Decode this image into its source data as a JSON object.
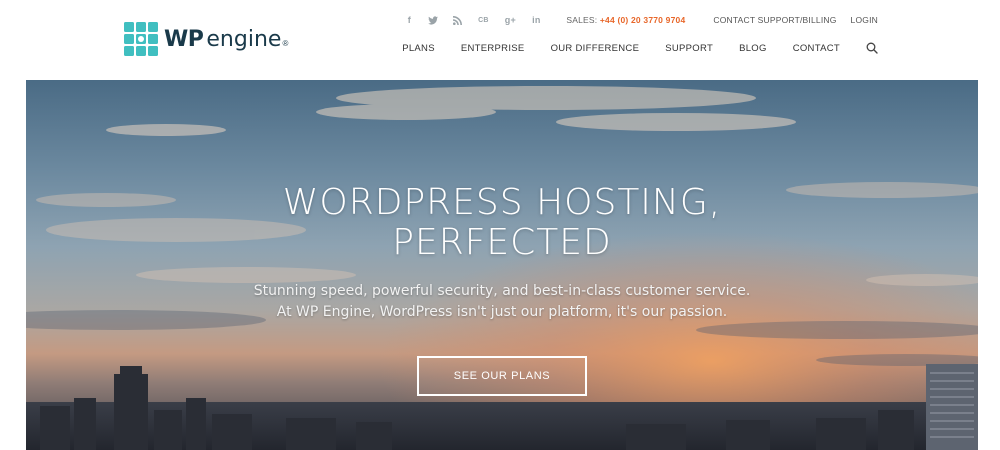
{
  "brand": {
    "wp": "WP",
    "engine": "engine",
    "reg": "®"
  },
  "social": [
    {
      "icon": "facebook-icon",
      "glyph": "f"
    },
    {
      "icon": "twitter-icon",
      "glyph": "t"
    },
    {
      "icon": "rss-icon",
      "glyph": "r"
    },
    {
      "icon": "cb-icon",
      "glyph": "CB"
    },
    {
      "icon": "google-plus-icon",
      "glyph": "g+"
    },
    {
      "icon": "linkedin-icon",
      "glyph": "in"
    }
  ],
  "utility": {
    "sales_label": "SALES:",
    "sales_phone": "+44 (0) 20 3770 9704",
    "contact_support": "CONTACT SUPPORT/BILLING",
    "login": "LOGIN"
  },
  "nav": {
    "items": [
      "PLANS",
      "ENTERPRISE",
      "OUR DIFFERENCE",
      "SUPPORT",
      "BLOG",
      "CONTACT"
    ]
  },
  "hero": {
    "title_line1": "WORDPRESS HOSTING,",
    "title_line2": "PERFECTED",
    "subtitle_line1": "Stunning speed, powerful security, and best-in-class customer service.",
    "subtitle_line2": "At WP Engine, WordPress isn't just our platform, it's our passion.",
    "cta": "SEE OUR PLANS"
  },
  "colors": {
    "accent_orange": "#e8672a",
    "logo_teal": "#40bfc0",
    "logo_dark": "#1a3a4a"
  }
}
